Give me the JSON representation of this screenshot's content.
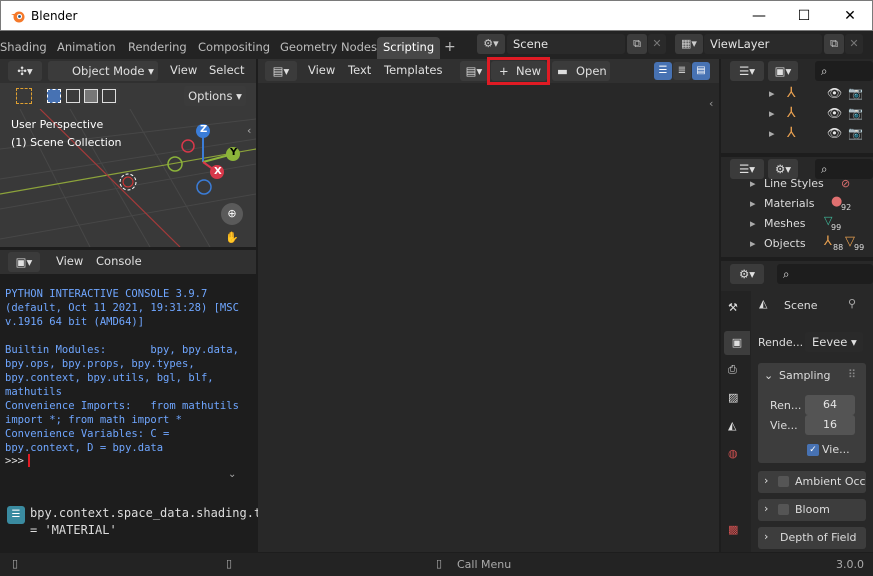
{
  "window": {
    "title": "Blender",
    "minimize": "—",
    "maximize": "☐",
    "close": "✕"
  },
  "workspaces": {
    "tabs": [
      "Shading",
      "Animation",
      "Rendering",
      "Compositing",
      "Geometry Nodes",
      "Scripting"
    ],
    "active": "Scripting",
    "add": "+"
  },
  "scene": {
    "value": "Scene"
  },
  "viewlayer": {
    "value": "ViewLayer"
  },
  "viewport": {
    "mode": "Object Mode",
    "menus": [
      "View",
      "Select"
    ],
    "options": "Options",
    "perspective": "User Perspective",
    "collection": "(1) Scene Collection",
    "axes": {
      "x": "X",
      "y": "Y",
      "z": "Z"
    }
  },
  "console": {
    "menus": [
      "View",
      "Console"
    ],
    "lines": "PYTHON INTERACTIVE CONSOLE 3.9.7 (default, Oct 11 2021, 19:31:28) [MSC v.1916 64 bit (AMD64)]\n\nBuiltin Modules:       bpy, bpy.data, bpy.ops, bpy.props, bpy.types, bpy.context, bpy.utils, bgl, blf, mathutils\nConvenience Imports:   from mathutils import *; from math import *\nConvenience Variables: C = bpy.context, D = bpy.data",
    "prompt": ">>>"
  },
  "info": {
    "line": "bpy.context.space_data.shading.type = 'MATERIAL'"
  },
  "texteditor": {
    "menus": [
      "View",
      "Text",
      "Templates"
    ],
    "new": "New",
    "open": "Open"
  },
  "outliner2": {
    "items": [
      "Line Styles",
      "Materials",
      "Meshes",
      "Objects"
    ],
    "badges": [
      "92",
      "99",
      "88",
      "99"
    ]
  },
  "properties": {
    "scene_label": "Scene",
    "render_label": "Rende...",
    "render_engine": "Eevee",
    "sampling": "Sampling",
    "render_samples_label": "Ren...",
    "render_samples": "64",
    "viewport_samples_label": "Vie...",
    "viewport_samples": "16",
    "viewport_denoise": "Vie...",
    "panels": [
      "Ambient Occl",
      "Bloom",
      "Depth of Field"
    ]
  },
  "status": {
    "call_menu": "Call Menu",
    "version": "3.0.0"
  },
  "colors": {
    "accent": "#4772b3",
    "highlight": "#e01b24"
  }
}
